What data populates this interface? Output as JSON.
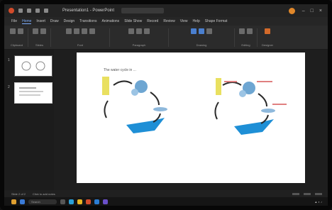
{
  "window": {
    "title": "Presentation1 - PowerPoint"
  },
  "ribbon_tabs": [
    "File",
    "Home",
    "Insert",
    "Draw",
    "Design",
    "Transitions",
    "Animations",
    "Slide Show",
    "Record",
    "Review",
    "View",
    "Help",
    "Shape Format"
  ],
  "ribbon_groups": [
    "Clipboard",
    "Slides",
    "Font",
    "Paragraph",
    "Drawing",
    "Editing",
    "Designer"
  ],
  "slides": [
    {
      "number": "1"
    },
    {
      "number": "2"
    }
  ],
  "slide": {
    "title": "The water cycle in ..."
  },
  "status": {
    "left": "Slide 2 of 2",
    "notes": "Click to add notes"
  },
  "taskbar": {
    "search_placeholder": "Search"
  },
  "colors": {
    "accent": "#4a7fcf",
    "water": "#1e8fd6",
    "cloud": "#6ea6d2",
    "sun": "#e9e060",
    "arrow": "#2a2a2a"
  }
}
